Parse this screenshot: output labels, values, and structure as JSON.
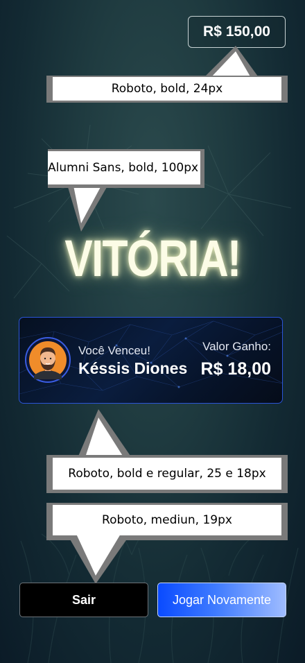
{
  "header": {
    "balance": "R$ 150,00"
  },
  "title": "VITÓRIA!",
  "card": {
    "subtitle": "Você Venceu!",
    "player_name": "Késsis Diones",
    "value_label": "Valor Ganho:",
    "value": "R$ 18,00"
  },
  "annotations": {
    "balance_font": "Roboto, bold, 24px",
    "title_font": "Alumni Sans, bold, 100px",
    "card_font": "Roboto, bold e regular, 25 e 18px",
    "buttons_font": "Roboto, mediun, 19px"
  },
  "buttons": {
    "exit_label": "Sair",
    "play_again_label": "Jogar Novamente"
  },
  "colors": {
    "background_top": "#2b4a4d",
    "background_bottom": "#0b1b27",
    "card_border": "#2b55d8",
    "accent_blue": "#0a4bff",
    "title_glow": "#fcfce6"
  },
  "icons": {
    "avatar": "bearded-man-avatar-icon"
  }
}
